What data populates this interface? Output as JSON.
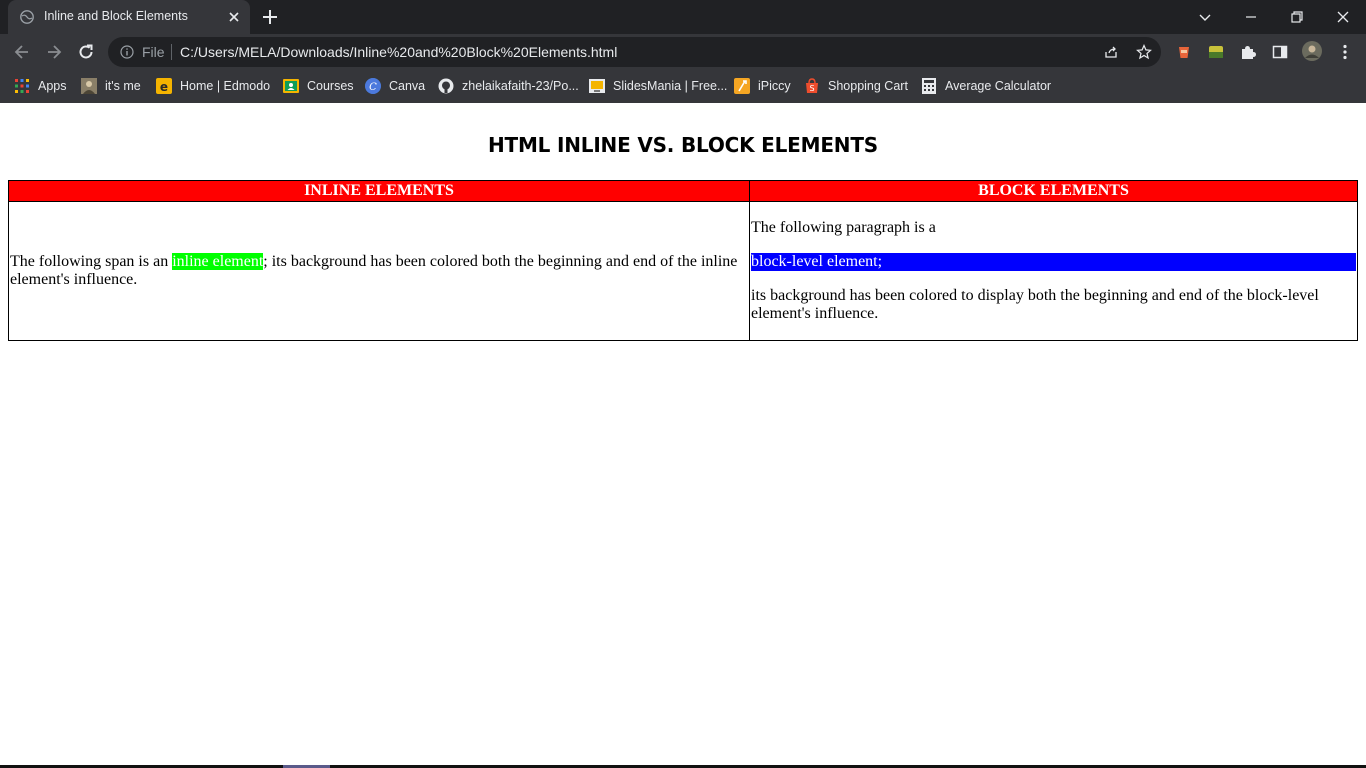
{
  "browser": {
    "tab": {
      "title": "Inline and Block Elements"
    },
    "address": {
      "scheme_label": "File",
      "url": "C:/Users/MELA/Downloads/Inline%20and%20Block%20Elements.html"
    },
    "bookmarks": [
      {
        "label": "Apps",
        "icon": "apps-grid-icon"
      },
      {
        "label": "it's me",
        "icon": "photo-icon"
      },
      {
        "label": "Home | Edmodo",
        "icon": "edmodo-icon"
      },
      {
        "label": "Courses",
        "icon": "classroom-icon"
      },
      {
        "label": "Canva",
        "icon": "canva-icon"
      },
      {
        "label": "zhelaikafaith-23/Po...",
        "icon": "github-icon"
      },
      {
        "label": "SlidesMania | Free...",
        "icon": "slides-icon"
      },
      {
        "label": "iPiccy",
        "icon": "ipiccy-icon"
      },
      {
        "label": "Shopping Cart",
        "icon": "shopping-bag-icon"
      },
      {
        "label": "Average Calculator",
        "icon": "calculator-icon"
      }
    ]
  },
  "page": {
    "title": "HTML INLINE VS. BLOCK ELEMENTS",
    "table": {
      "headers": [
        "INLINE ELEMENTS",
        "BLOCK ELEMENTS"
      ],
      "inline_cell": {
        "before": "The following span is an ",
        "span": "inline element",
        "after": "; its background has been colored both the beginning and end of the inline element's influence."
      },
      "block_cell": {
        "p1": "The following paragraph is a",
        "div": "block-level element;",
        "p2": "its background has been colored to display both the beginning and end of the block-level element's influence."
      }
    }
  },
  "colors": {
    "header_bg": "#ff0000",
    "inline_bg": "#00ff00",
    "block_bg": "#0000ff"
  }
}
